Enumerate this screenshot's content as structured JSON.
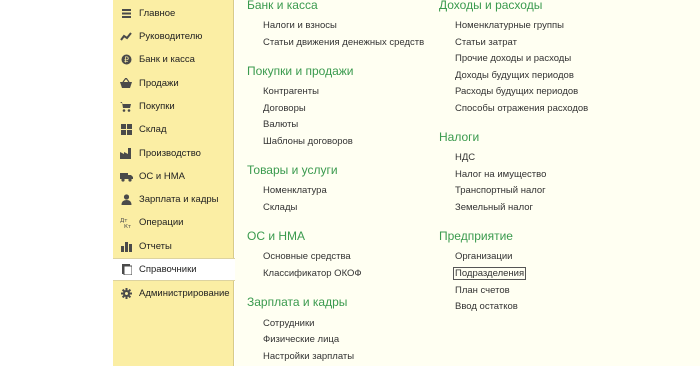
{
  "sidebar": {
    "items": [
      {
        "label": "Главное",
        "icon": "menu-lines-icon"
      },
      {
        "label": "Руководителю",
        "icon": "trend-chart-icon"
      },
      {
        "label": "Банк и касса",
        "icon": "coin-icon"
      },
      {
        "label": "Продажи",
        "icon": "shopping-basket-icon"
      },
      {
        "label": "Покупки",
        "icon": "shopping-cart-icon"
      },
      {
        "label": "Склад",
        "icon": "warehouse-grid-icon"
      },
      {
        "label": "Производство",
        "icon": "factory-icon"
      },
      {
        "label": "ОС и НМА",
        "icon": "truck-icon"
      },
      {
        "label": "Зарплата и кадры",
        "icon": "person-icon"
      },
      {
        "label": "Операции",
        "icon": "dt-kt-icon"
      },
      {
        "label": "Отчеты",
        "icon": "bar-chart-icon"
      },
      {
        "label": "Справочники",
        "icon": "book-icon",
        "active": true
      },
      {
        "label": "Администрирование",
        "icon": "gear-icon"
      }
    ]
  },
  "left_column": [
    {
      "title": "Банк и касса",
      "links": [
        "Налоги и взносы",
        "Статьи движения денежных средств"
      ]
    },
    {
      "title": "Покупки и продажи",
      "links": [
        "Контрагенты",
        "Договоры",
        "Валюты",
        "Шаблоны договоров"
      ]
    },
    {
      "title": "Товары и услуги",
      "links": [
        "Номенклатура",
        "Склады"
      ]
    },
    {
      "title": "ОС и НМА",
      "links": [
        "Основные средства",
        "Классификатор ОКОФ"
      ]
    },
    {
      "title": "Зарплата и кадры",
      "links": [
        "Сотрудники",
        "Физические лица",
        "Настройки зарплаты"
      ]
    }
  ],
  "right_column": [
    {
      "title": "Доходы и расходы",
      "links": [
        "Номенклатурные группы",
        "Статьи затрат",
        "Прочие доходы и расходы",
        "Доходы будущих периодов",
        "Расходы будущих периодов",
        "Способы отражения расходов"
      ]
    },
    {
      "title": "Налоги",
      "links": [
        "НДС",
        "Налог на имущество",
        "Транспортный налог",
        "Земельный налог"
      ]
    },
    {
      "title": "Предприятие",
      "links": [
        "Организации",
        "Подразделения",
        "План счетов",
        "Ввод остатков"
      ]
    }
  ],
  "focused_link": "Подразделения",
  "colors": {
    "sidebar_bg": "#fbeea4",
    "content_bg": "#fffff2",
    "section_title": "#3a9a4e",
    "icon": "#4a4a4a"
  }
}
